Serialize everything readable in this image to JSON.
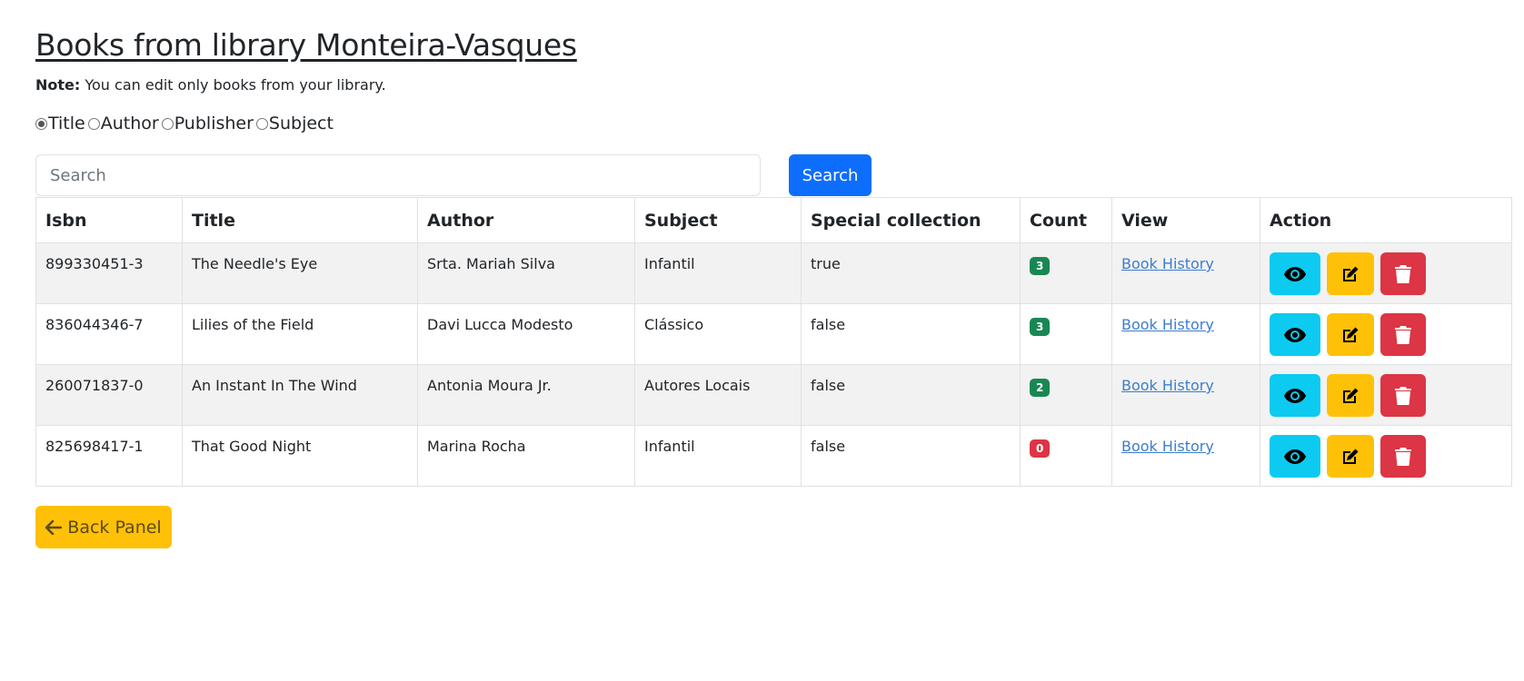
{
  "page": {
    "title": "Books from library Monteira-Vasques",
    "note_label": "Note:",
    "note_text": " You can edit only books from your library."
  },
  "search_by": {
    "options": [
      "Title",
      "Author",
      "Publisher",
      "Subject"
    ],
    "selected": "Title"
  },
  "search": {
    "placeholder": "Search",
    "value": "",
    "button_label": "Search"
  },
  "table": {
    "headers": [
      "Isbn",
      "Title",
      "Author",
      "Subject",
      "Special collection",
      "Count",
      "View",
      "Action"
    ],
    "rows": [
      {
        "isbn": "899330451-3",
        "title": "The Needle's Eye",
        "author": "Srta. Mariah Silva",
        "subject": "Infantil",
        "special": "true",
        "count": "3",
        "count_color": "green",
        "view": "Book History"
      },
      {
        "isbn": "836044346-7",
        "title": "Lilies of the Field",
        "author": "Davi Lucca Modesto",
        "subject": "Clássico",
        "special": "false",
        "count": "3",
        "count_color": "green",
        "view": "Book History"
      },
      {
        "isbn": "260071837-0",
        "title": "An Instant In The Wind",
        "author": "Antonia Moura Jr.",
        "subject": "Autores Locais",
        "special": "false",
        "count": "2",
        "count_color": "green",
        "view": "Book History"
      },
      {
        "isbn": "825698417-1",
        "title": "That Good Night",
        "author": "Marina Rocha",
        "subject": "Infantil",
        "special": "false",
        "count": "0",
        "count_color": "red",
        "view": "Book History"
      }
    ],
    "action_icons": [
      "eye-icon",
      "edit-icon",
      "trash-icon"
    ]
  },
  "back": {
    "label": "Back Panel",
    "icon": "arrow-left-icon"
  },
  "colors": {
    "primary": "#0d6efd",
    "info": "#0dcaf0",
    "warning": "#ffc107",
    "danger": "#dc3545",
    "success": "#198754",
    "link": "#3c7dce"
  }
}
